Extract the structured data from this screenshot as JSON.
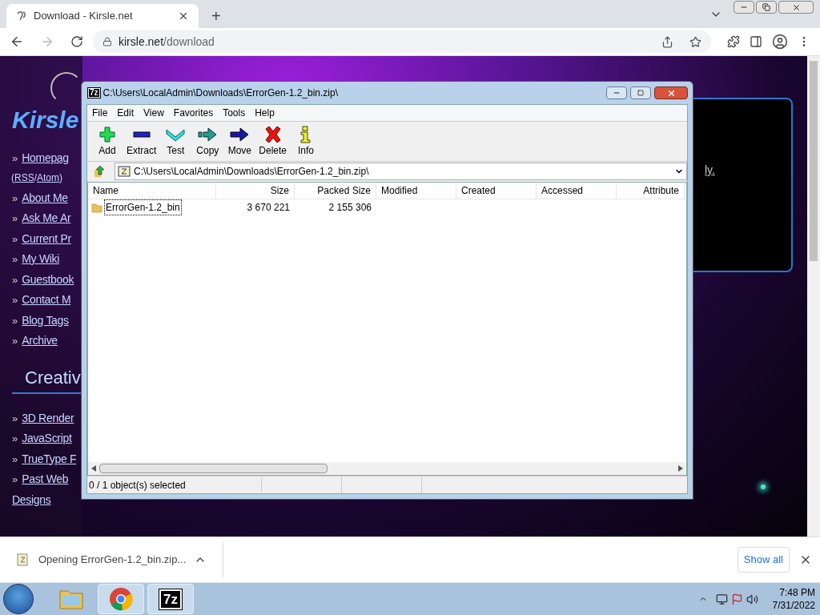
{
  "browser": {
    "tab": {
      "title": "Download - Kirsle.net",
      "selected": true
    },
    "new_tab": "+",
    "url_host": "kirsle.net",
    "url_path": "/download"
  },
  "page": {
    "logo": "Kirsle",
    "bullet": "»",
    "nav": [
      "Homepag",
      "About Me",
      "Ask Me Ar",
      "Current Pr",
      "My Wiki",
      "Guestbook",
      "Contact M",
      "Blog Tags",
      "Archive"
    ],
    "feeds": {
      "open": "(",
      "links": [
        "RSS",
        "Atom"
      ],
      "separator": "/",
      "close": ")"
    },
    "section_heading": "Creativ",
    "creative": [
      {
        "lines": [
          "3D Render"
        ]
      },
      {
        "lines": [
          "JavaScript"
        ]
      },
      {
        "lines": [
          "TrueType F"
        ]
      },
      {
        "lines": [
          "Past Web",
          "Designs"
        ]
      }
    ],
    "panel_text": "ly."
  },
  "window": {
    "title": "C:\\Users\\LocalAdmin\\Downloads\\ErrorGen-1.2_bin.zip\\",
    "icon_text": "7z",
    "menu": [
      "File",
      "Edit",
      "View",
      "Favorites",
      "Tools",
      "Help"
    ],
    "toolbar": [
      {
        "label": "Add",
        "kind": "add"
      },
      {
        "label": "Extract",
        "kind": "extract"
      },
      {
        "label": "Test",
        "kind": "test"
      },
      {
        "label": "Copy",
        "kind": "copy"
      },
      {
        "label": "Move",
        "kind": "move"
      },
      {
        "label": "Delete",
        "kind": "delete"
      },
      {
        "label": "Info",
        "kind": "info"
      }
    ],
    "address": "C:\\Users\\LocalAdmin\\Downloads\\ErrorGen-1.2_bin.zip\\",
    "columns": [
      "Name",
      "Size",
      "Packed Size",
      "Modified",
      "Created",
      "Accessed",
      "Attribute"
    ],
    "rows": [
      {
        "name": "ErrorGen-1.2_bin",
        "size": "3 670 221",
        "packed_size": "2 155 306",
        "focused": true
      }
    ],
    "status": "0 / 1 object(s) selected"
  },
  "downloads": {
    "item": "Opening ErrorGen-1.2_bin.zip...",
    "show_all": "Show all"
  },
  "taskbar": {
    "apps": [
      {
        "kind": "explorer",
        "active": false
      },
      {
        "kind": "chrome",
        "active": true
      },
      {
        "kind": "sevenzip",
        "label": "7z",
        "active": true
      }
    ],
    "time": "7:48 PM",
    "date": "7/31/2022"
  }
}
